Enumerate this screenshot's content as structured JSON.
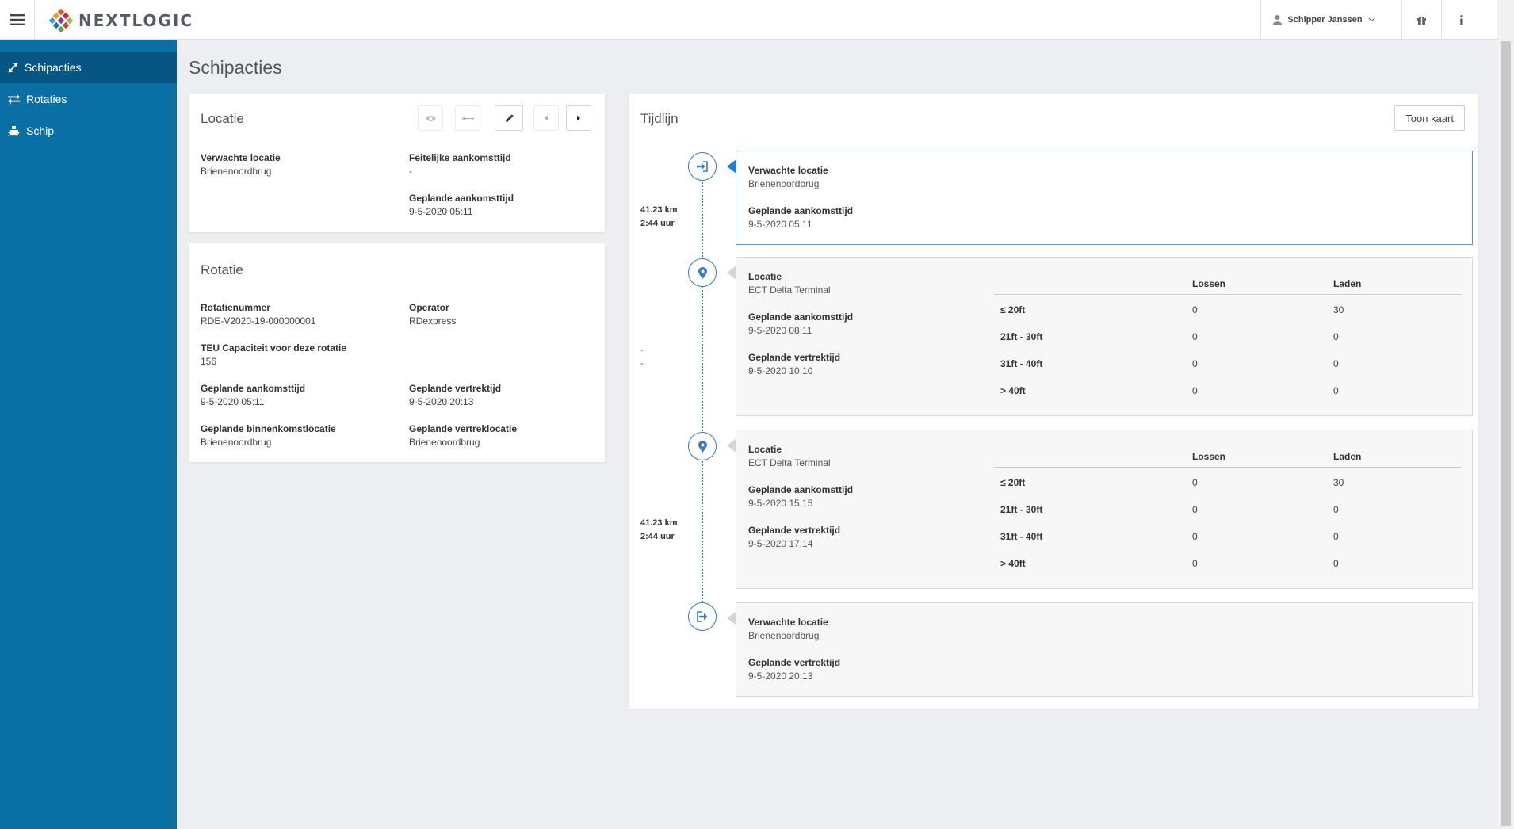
{
  "app": {
    "brand": "NEXTLOGIC",
    "user": "Schipper Janssen"
  },
  "sidebar": {
    "items": [
      {
        "label": "Schipacties",
        "icon": "expand-arrows-icon",
        "active": true
      },
      {
        "label": "Rotaties",
        "icon": "exchange-icon",
        "active": false
      },
      {
        "label": "Schip",
        "icon": "ship-icon",
        "active": false
      }
    ]
  },
  "page": {
    "title": "Schipacties"
  },
  "locatie": {
    "title": "Locatie",
    "verwachte_locatie_label": "Verwachte locatie",
    "verwachte_locatie_value": "Brienenoordbrug",
    "feitelijke_label": "Feitelijke aankomsttijd",
    "feitelijke_value": "-",
    "geplande_label": "Geplande aankomsttijd",
    "geplande_value": "9-5-2020 05:11"
  },
  "rotatie": {
    "title": "Rotatie",
    "nummer_label": "Rotatienummer",
    "nummer_value": "RDE-V2020-19-000000001",
    "operator_label": "Operator",
    "operator_value": "RDexpress",
    "teu_label": "TEU Capaciteit voor deze rotatie",
    "teu_value": "156",
    "aankomst_label": "Geplande aankomsttijd",
    "aankomst_value": "9-5-2020 05:11",
    "vertrek_label": "Geplande vertrektijd",
    "vertrek_value": "9-5-2020 20:13",
    "binnenkomst_label": "Geplande binnenkomstlocatie",
    "binnenkomst_value": "Brienenoordbrug",
    "vertreklocatie_label": "Geplande vertreklocatie",
    "vertreklocatie_value": "Brienenoordbrug"
  },
  "tijdlijn": {
    "title": "Tijdlijn",
    "toon_kaart": "Toon kaart",
    "segments": [
      {
        "km": "41.23 km",
        "time": "2:44 uur"
      },
      {
        "km": "-",
        "time": "-"
      },
      {
        "km": "41.23 km",
        "time": "2:44 uur"
      }
    ],
    "cargo_headers": {
      "lossen": "Lossen",
      "laden": "Laden"
    },
    "entries": [
      {
        "f1_label": "Verwachte locatie",
        "f1_value": "Brienenoordbrug",
        "f2_label": "Geplande aankomsttijd",
        "f2_value": "9-5-2020 05:11"
      },
      {
        "f1_label": "Locatie",
        "f1_value": "ECT Delta Terminal",
        "f2_label": "Geplande aankomsttijd",
        "f2_value": "9-5-2020 08:11",
        "f3_label": "Geplande vertrektijd",
        "f3_value": "9-5-2020 10:10",
        "cargo": [
          {
            "size": "≤ 20ft",
            "lossen": "0",
            "laden": "30"
          },
          {
            "size": "21ft - 30ft",
            "lossen": "0",
            "laden": "0"
          },
          {
            "size": "31ft - 40ft",
            "lossen": "0",
            "laden": "0"
          },
          {
            "size": "> 40ft",
            "lossen": "0",
            "laden": "0"
          }
        ]
      },
      {
        "f1_label": "Locatie",
        "f1_value": "ECT Delta Terminal",
        "f2_label": "Geplande aankomsttijd",
        "f2_value": "9-5-2020 15:15",
        "f3_label": "Geplande vertrektijd",
        "f3_value": "9-5-2020 17:14",
        "cargo": [
          {
            "size": "≤ 20ft",
            "lossen": "0",
            "laden": "30"
          },
          {
            "size": "21ft - 30ft",
            "lossen": "0",
            "laden": "0"
          },
          {
            "size": "31ft - 40ft",
            "lossen": "0",
            "laden": "0"
          },
          {
            "size": "> 40ft",
            "lossen": "0",
            "laden": "0"
          }
        ]
      },
      {
        "f1_label": "Verwachte locatie",
        "f1_value": "Brienenoordbrug",
        "f2_label": "Geplande vertrektijd",
        "f2_value": "9-5-2020 20:13"
      }
    ]
  },
  "colors": {
    "sidebar": "#0a6fa5",
    "sidebar_active": "#075583",
    "accent": "#3a7abf",
    "active_border": "#4a9be3"
  }
}
